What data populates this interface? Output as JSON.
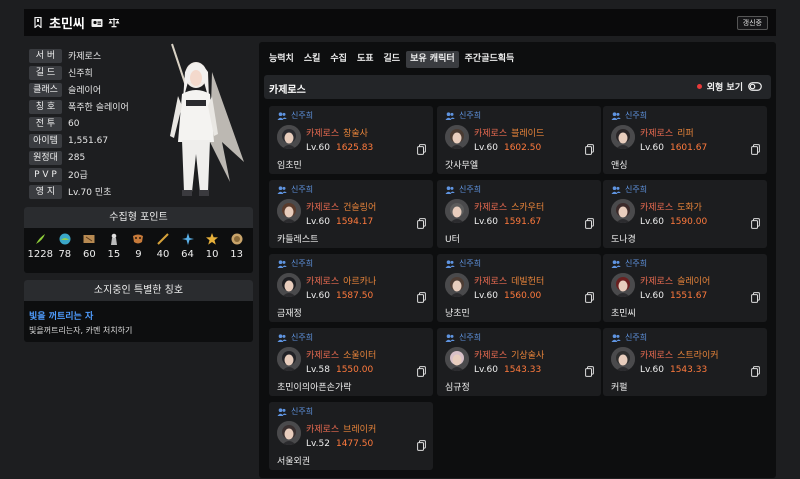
{
  "header": {
    "name": "초민씨",
    "renew_label": "갱신중"
  },
  "profile": {
    "rows": [
      {
        "label": "서 버",
        "value": "카제로스"
      },
      {
        "label": "길 드",
        "value": "신주희"
      },
      {
        "label": "클래스",
        "value": "슬레이어"
      },
      {
        "label": "칭 호",
        "value": "폭주한 슬레이어"
      },
      {
        "label": "전 투",
        "value": "60"
      },
      {
        "label": "아이템",
        "value": "1,551.67"
      },
      {
        "label": "원정대",
        "value": "285"
      },
      {
        "label": "P V P",
        "value": "20급"
      },
      {
        "label": "영 지",
        "value": "Lv.70 민초"
      }
    ]
  },
  "collect": {
    "title": "수집형 포인트",
    "items": [
      {
        "icon": "seed-icon",
        "value": "1228"
      },
      {
        "icon": "island-icon",
        "value": "78"
      },
      {
        "icon": "map-icon",
        "value": "60"
      },
      {
        "icon": "statue-icon",
        "value": "15"
      },
      {
        "icon": "mask-icon",
        "value": "9"
      },
      {
        "icon": "wand-icon",
        "value": "40"
      },
      {
        "icon": "leaf-icon",
        "value": "64"
      },
      {
        "icon": "star-icon",
        "value": "10"
      },
      {
        "icon": "medal-icon",
        "value": "13"
      }
    ]
  },
  "titles": {
    "title": "소지중인 특별한 칭호",
    "name": "빛을 꺼트리는 자",
    "desc": "빛을꺼트리는자, 카멘 처치하기"
  },
  "tabs": [
    "능력치",
    "스킬",
    "수집",
    "도표",
    "길드",
    "보유 캐릭터",
    "주간골드획득"
  ],
  "active_tab": 5,
  "server_section": {
    "name": "카제로스",
    "toggle_label": "외형 보기"
  },
  "characters": [
    {
      "guild": "신주희",
      "server": "카제로스",
      "job": "창술사",
      "level": "Lv.60",
      "ilvl": "1625.83",
      "name": "임초민",
      "hair": "#2b2b30"
    },
    {
      "guild": "신주희",
      "server": "카제로스",
      "job": "블레이드",
      "level": "Lv.60",
      "ilvl": "1602.50",
      "name": "갓사무엘",
      "hair": "#4a3b32"
    },
    {
      "guild": "신주희",
      "server": "카제로스",
      "job": "리퍼",
      "level": "Lv.60",
      "ilvl": "1601.67",
      "name": "앤싱",
      "hair": "#2a2628"
    },
    {
      "guild": "신주희",
      "server": "카제로스",
      "job": "건슬링어",
      "level": "Lv.60",
      "ilvl": "1594.17",
      "name": "카들레스트",
      "hair": "#5a3b2c"
    },
    {
      "guild": "신주희",
      "server": "카제로스",
      "job": "스카우터",
      "level": "Lv.60",
      "ilvl": "1591.67",
      "name": "U터",
      "hair": "#5c5c5c"
    },
    {
      "guild": "신주희",
      "server": "카제로스",
      "job": "도화가",
      "level": "Lv.60",
      "ilvl": "1590.00",
      "name": "도나경",
      "hair": "#3b2a2a"
    },
    {
      "guild": "신주희",
      "server": "카제로스",
      "job": "아르카나",
      "level": "Lv.60",
      "ilvl": "1587.50",
      "name": "금재정",
      "hair": "#1e1e22"
    },
    {
      "guild": "신주희",
      "server": "카제로스",
      "job": "데빌헌터",
      "level": "Lv.60",
      "ilvl": "1560.00",
      "name": "냥초민",
      "hair": "#4e3d34"
    },
    {
      "guild": "신주희",
      "server": "카제로스",
      "job": "슬레이어",
      "level": "Lv.60",
      "ilvl": "1551.67",
      "name": "초민씨",
      "hair": "#6a2020"
    },
    {
      "guild": "신주희",
      "server": "카제로스",
      "job": "소울이터",
      "level": "Lv.58",
      "ilvl": "1550.00",
      "name": "초민이의아픈손가락",
      "hair": "#222226"
    },
    {
      "guild": "신주희",
      "server": "카제로스",
      "job": "기상술사",
      "level": "Lv.60",
      "ilvl": "1543.33",
      "name": "심규정",
      "hair": "#d8c0c8"
    },
    {
      "guild": "신주희",
      "server": "카제로스",
      "job": "스트라이커",
      "level": "Lv.60",
      "ilvl": "1543.33",
      "name": "커펄",
      "hair": "#2e2e2e"
    },
    {
      "guild": "신주희",
      "server": "카제로스",
      "job": "브레이커",
      "level": "Lv.52",
      "ilvl": "1477.50",
      "name": "서울외권",
      "hair": "#3a3030"
    }
  ],
  "colors": {
    "accent_blue": "#4f9dff",
    "ilvl_orange": "#ff7a3d",
    "job_orange": "#e8843a"
  }
}
